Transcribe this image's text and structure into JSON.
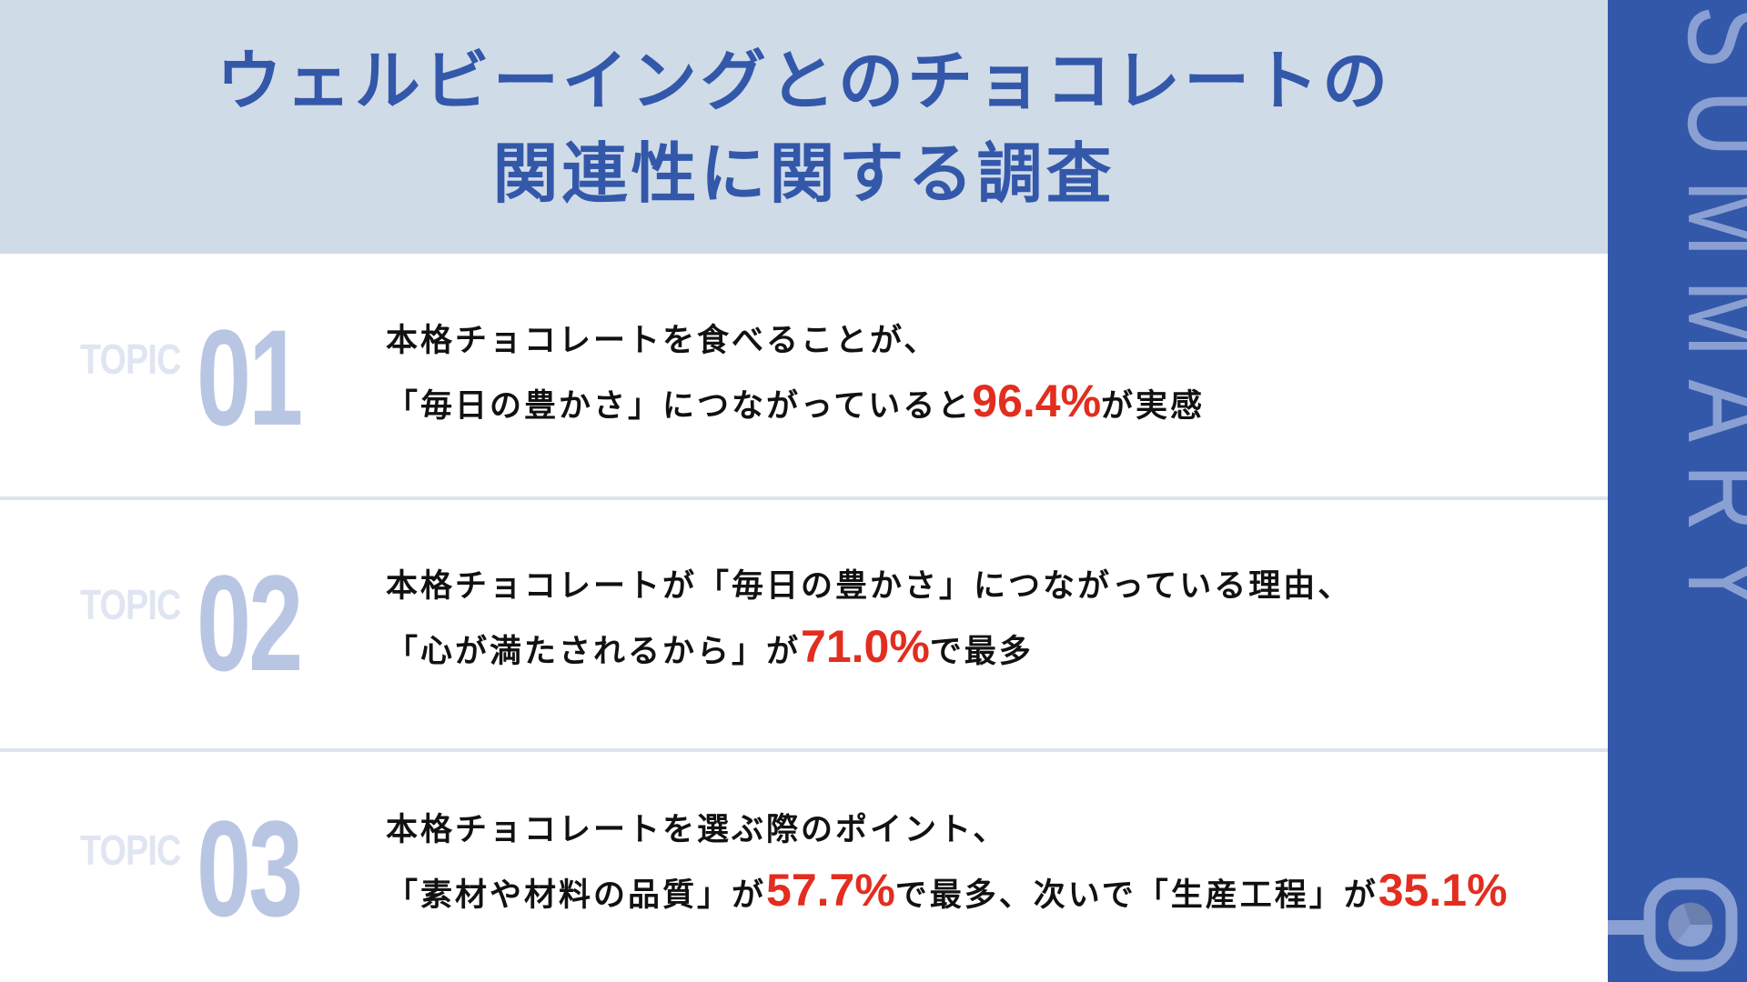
{
  "title": {
    "line1": "ウェルビーイングとのチョコレートの",
    "line2": "関連性に関する調査"
  },
  "sidebar": {
    "label": "SUMMARY",
    "icon": "pie-chart-search-icon"
  },
  "colors": {
    "accent_blue": "#3358aa",
    "header_bg": "#d0dbe8",
    "highlight_red": "#e22d1f",
    "topic_number": "#b9c6e3",
    "topic_label": "#dfe5f1"
  },
  "topics": [
    {
      "label": "TOPIC",
      "number": "01",
      "line1": "本格チョコレートを食べることが、",
      "line2_before": "「毎日の豊かさ」につながっていると",
      "line2_pct": "96.4%",
      "line2_after": "が実感"
    },
    {
      "label": "TOPIC",
      "number": "02",
      "line1": "本格チョコレートが「毎日の豊かさ」につながっている理由、",
      "line2_before": "「心が満たされるから」が",
      "line2_pct": "71.0%",
      "line2_after": "で最多"
    },
    {
      "label": "TOPIC",
      "number": "03",
      "line1": "本格チョコレートを選ぶ際のポイント、",
      "line2_before": "「素材や材料の品質」が",
      "line2_pct": "57.7%",
      "line2_mid": "で最多、次いで「生産工程」が",
      "line2_pct2": "35.1%"
    }
  ]
}
